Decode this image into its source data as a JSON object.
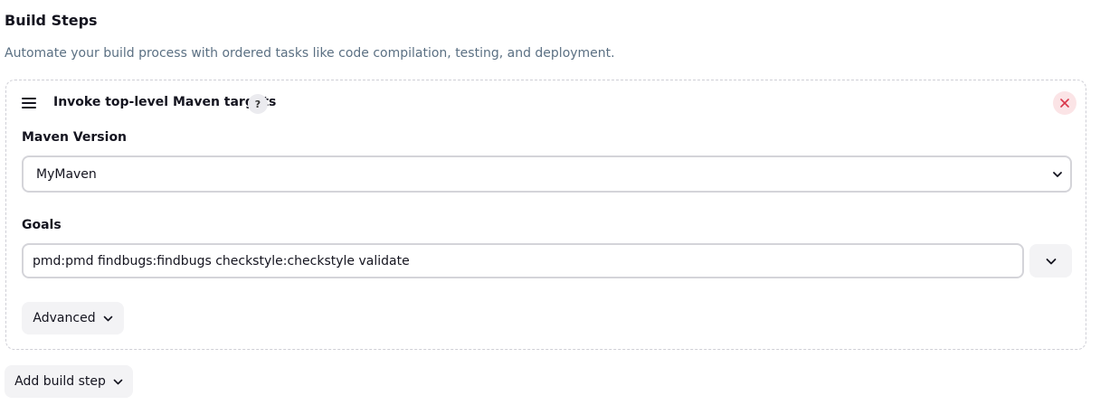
{
  "section": {
    "title": "Build Steps",
    "description": "Automate your build process with ordered tasks like code compilation, testing, and deployment."
  },
  "step": {
    "title": "Invoke top-level Maven targets",
    "help_label": "?",
    "drag_icon": "drag-handle-icon",
    "close_icon": "close-icon",
    "maven_version": {
      "label": "Maven Version",
      "selected": "MyMaven"
    },
    "goals": {
      "label": "Goals",
      "value": "pmd:pmd findbugs:findbugs checkstyle:checkstyle validate"
    },
    "advanced_label": "Advanced"
  },
  "add_build_step_label": "Add build step",
  "colors": {
    "description": "#5b7083",
    "close_bg": "#fbe4e6",
    "close_x": "#d9364a",
    "button_bg": "#f3f3f5"
  }
}
